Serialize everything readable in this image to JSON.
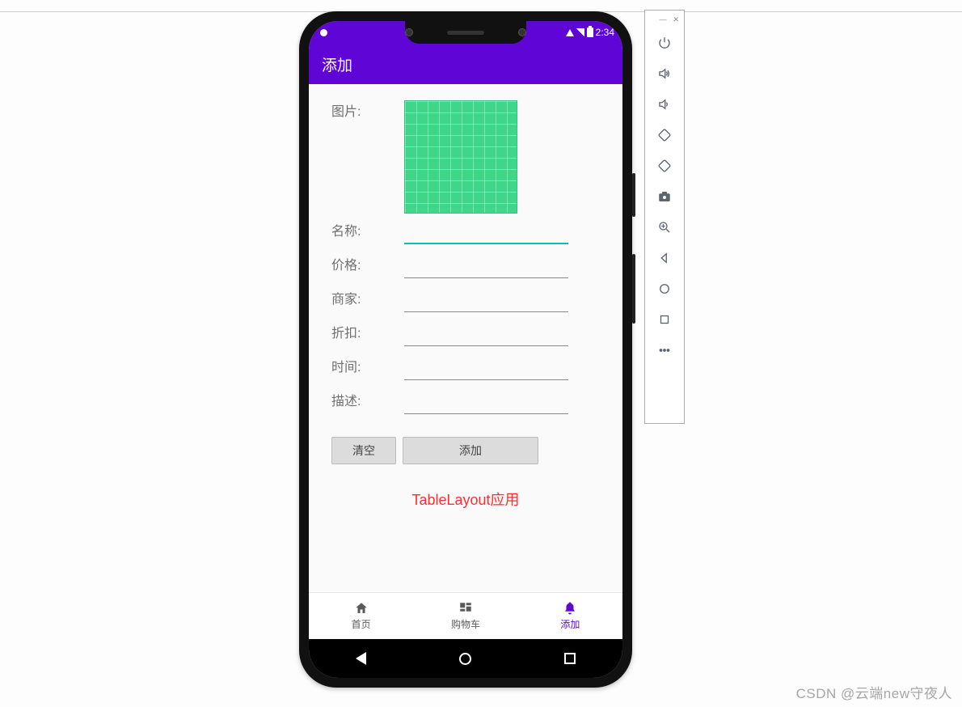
{
  "status": {
    "time": "2:34"
  },
  "actionBar": {
    "title": "添加"
  },
  "form": {
    "labels": {
      "image": "图片:",
      "name": "名称:",
      "price": "价格:",
      "merchant": "商家:",
      "discount": "折扣:",
      "time": "时间:",
      "desc": "描述:"
    },
    "values": {
      "name": "",
      "price": "",
      "merchant": "",
      "discount": "",
      "time": "",
      "desc": ""
    }
  },
  "buttons": {
    "clear": "清空",
    "add": "添加"
  },
  "callout": "TableLayout应用",
  "bottomNav": {
    "items": [
      {
        "label": "首页",
        "icon": "home"
      },
      {
        "label": "购物车",
        "icon": "cart"
      },
      {
        "label": "添加",
        "icon": "bell"
      }
    ],
    "activeIndex": 2
  },
  "emulatorToolbar": {
    "controls": [
      "power",
      "volume-up",
      "volume-down",
      "rotate-left",
      "rotate-right",
      "camera",
      "zoom",
      "back",
      "home",
      "recent",
      "more"
    ]
  },
  "watermark": "CSDN @云端new守夜人"
}
